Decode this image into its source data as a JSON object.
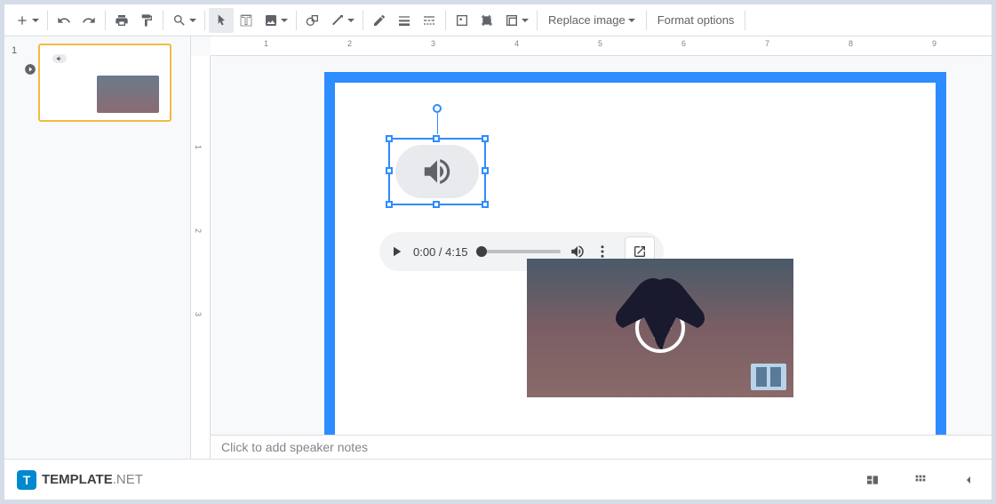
{
  "toolbar": {
    "replace_image": "Replace image",
    "format_options": "Format options"
  },
  "sidebar": {
    "slide_number": "1"
  },
  "audio_player": {
    "current_time": "0:00",
    "duration": "4:15",
    "time_display": "0:00 / 4:15"
  },
  "ruler": {
    "h": [
      "1",
      "2",
      "3",
      "4",
      "5",
      "6",
      "7",
      "8",
      "9"
    ],
    "v": [
      "1",
      "2",
      "3"
    ]
  },
  "notes": {
    "placeholder": "Click to add speaker notes"
  },
  "footer": {
    "brand": "TEMPLATE",
    "tld": ".NET"
  }
}
